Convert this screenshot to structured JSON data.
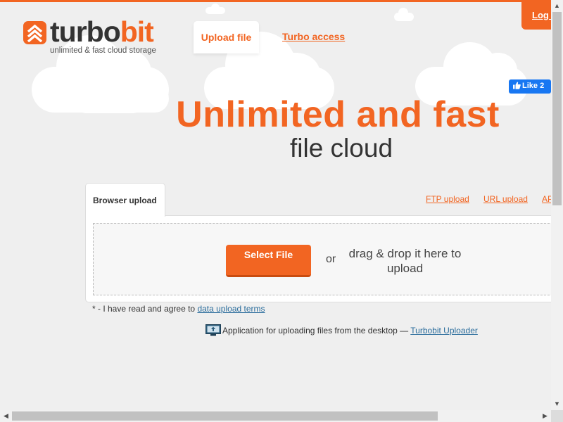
{
  "brand": {
    "name_part1": "turbo",
    "name_part2": "bit",
    "tagline": "unlimited & fast cloud storage",
    "accent_color": "#f26522"
  },
  "nav": {
    "upload_file": "Upload file",
    "turbo_access": "Turbo access",
    "login": "Log in"
  },
  "social": {
    "fb_like": "Like 2"
  },
  "hero": {
    "line1": "Unlimited and fast",
    "line2": "file cloud"
  },
  "upload": {
    "tabs": [
      {
        "label": "Browser upload",
        "active": true
      },
      {
        "label": "FTP upload"
      },
      {
        "label": "URL upload"
      },
      {
        "label": "API"
      }
    ],
    "select_button": "Select File",
    "or": "or",
    "drop_hint": "drag & drop it here to upload"
  },
  "terms": {
    "prefix": "* - I have read and agree to ",
    "link": "data upload terms"
  },
  "uploader": {
    "text": "Application for uploading files from the desktop — ",
    "link": "Turbobit Uploader",
    "icon": "desktop-upload-icon"
  }
}
